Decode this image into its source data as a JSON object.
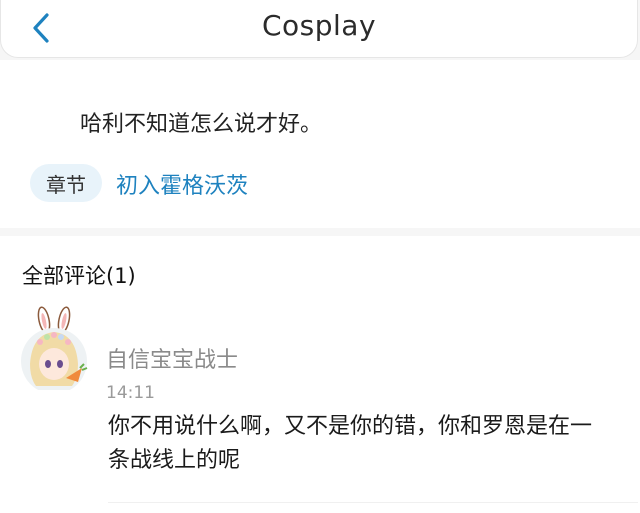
{
  "header": {
    "title": "Cosplay",
    "back_icon": "chevron-left-icon",
    "accent": "#1e82bf"
  },
  "quote": {
    "text": "哈利不知道怎么说才好。",
    "chapter_badge": "章节",
    "chapter_link": "初入霍格沃茨"
  },
  "comments": {
    "title": "全部评论(1)",
    "items": [
      {
        "username": "自信宝宝战士",
        "time": "14:11",
        "text": "你不用说什么啊，又不是你的错，你和罗恩是在一条战线上的呢"
      }
    ]
  }
}
